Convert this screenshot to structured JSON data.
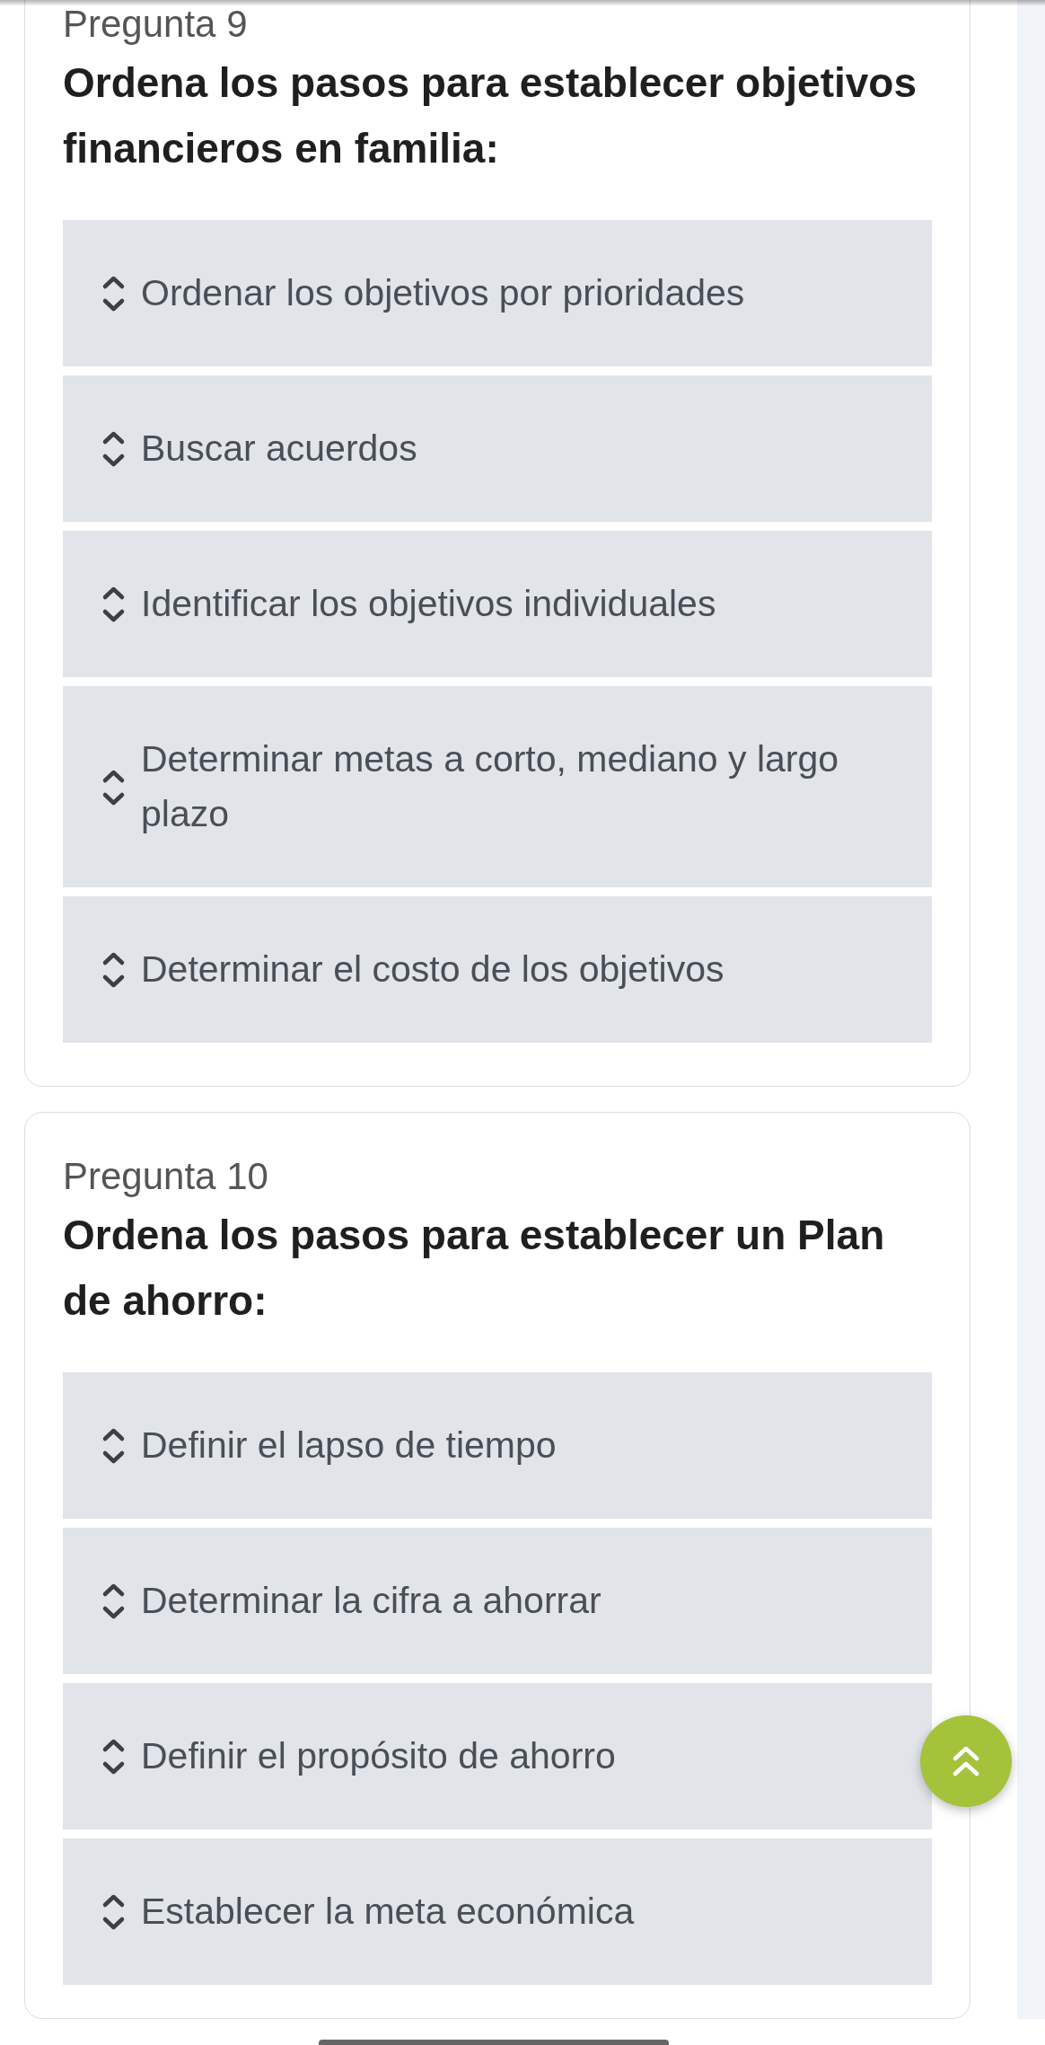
{
  "questions": [
    {
      "number": "Pregunta 9",
      "prompt": "Ordena los pasos para establecer objetivos financieros en familia:",
      "steps": [
        "Ordenar los objetivos por prioridades",
        "Buscar acuerdos",
        "Identificar los objetivos individuales",
        "Determinar metas a corto, mediano y largo plazo",
        "Determinar el costo de los objetivos"
      ]
    },
    {
      "number": "Pregunta 10",
      "prompt": "Ordena los pasos para establecer un Plan de ahorro:",
      "steps": [
        "Definir el lapso de tiempo",
        "Determinar la cifra a ahorrar",
        "Definir el propósito de ahorro",
        "Establecer la meta económica"
      ]
    }
  ]
}
